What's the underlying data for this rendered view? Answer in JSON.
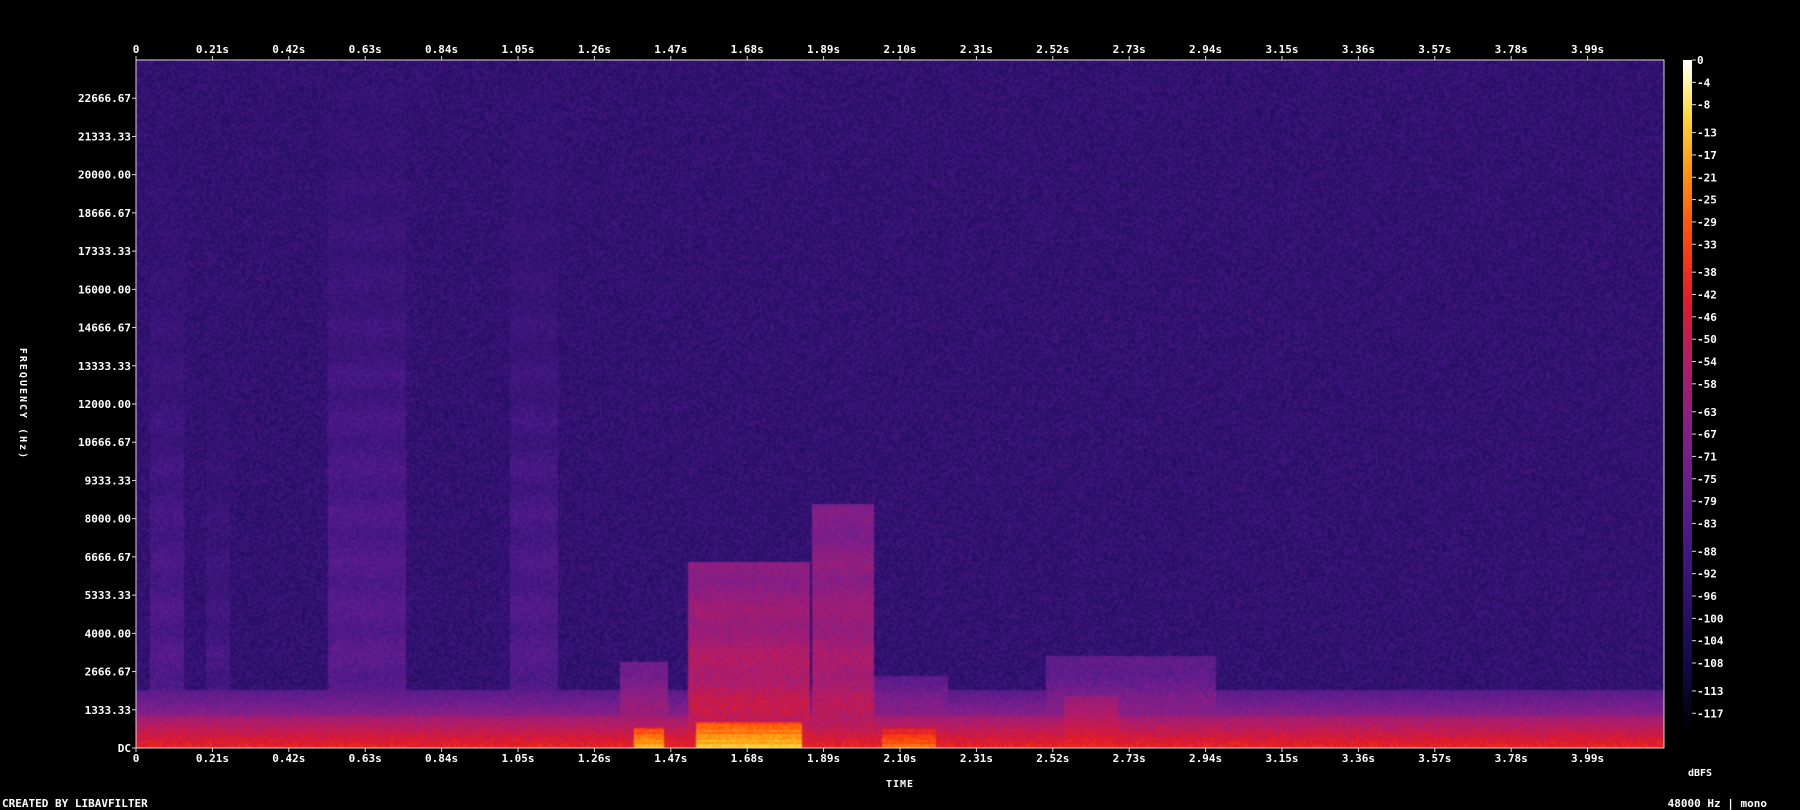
{
  "chart_data": {
    "type": "heatmap",
    "title": "",
    "xlabel": "TIME",
    "ylabel": "FREQUENCY (Hz)",
    "x_tick_labels": [
      "0",
      "0.21s",
      "0.42s",
      "0.63s",
      "0.84s",
      "1.05s",
      "1.26s",
      "1.47s",
      "1.68s",
      "1.89s",
      "2.10s",
      "2.31s",
      "2.52s",
      "2.73s",
      "2.94s",
      "3.15s",
      "3.36s",
      "3.57s",
      "3.78s",
      "3.99s"
    ],
    "x_ticks": [
      0,
      0.21,
      0.42,
      0.63,
      0.84,
      1.05,
      1.26,
      1.47,
      1.68,
      1.89,
      2.1,
      2.31,
      2.52,
      2.73,
      2.94,
      3.15,
      3.36,
      3.57,
      3.78,
      3.99
    ],
    "xlim": [
      0,
      4.2
    ],
    "y_tick_labels": [
      "DC",
      "1333.33",
      "2666.67",
      "4000.00",
      "5333.33",
      "6666.67",
      "8000.00",
      "9333.33",
      "10666.67",
      "12000.00",
      "13333.33",
      "14666.67",
      "16000.00",
      "17333.33",
      "18666.67",
      "20000.00",
      "21333.33",
      "22666.67"
    ],
    "y_ticks": [
      0,
      1333.33,
      2666.67,
      4000,
      5333.33,
      6666.67,
      8000,
      9333.33,
      10666.67,
      12000,
      13333.33,
      14666.67,
      16000,
      17333.33,
      18666.67,
      20000,
      21333.33,
      22666.67
    ],
    "ylim": [
      0,
      24000
    ],
    "colorbar": {
      "unit": "dBFS",
      "tick_labels": [
        "0",
        "-4",
        "-8",
        "-13",
        "-17",
        "-21",
        "-25",
        "-29",
        "-33",
        "-38",
        "-42",
        "-46",
        "-50",
        "-54",
        "-58",
        "-63",
        "-67",
        "-71",
        "-75",
        "-79",
        "-83",
        "-88",
        "-92",
        "-96",
        "-100",
        "-104",
        "-108",
        "-113",
        "-117"
      ],
      "range": [
        -120,
        0
      ],
      "colors": [
        "#000000",
        "#0b0a40",
        "#2a0f6a",
        "#4d1a8a",
        "#7a1f8c",
        "#b01c6a",
        "#e01a2a",
        "#ff4a0a",
        "#ff9a10",
        "#ffd93a",
        "#fff6b0",
        "#ffffff"
      ]
    },
    "background_level_dbfs": -95,
    "events": [
      {
        "t0": 0.04,
        "t1": 0.13,
        "fmax": 21000,
        "level": -82
      },
      {
        "t0": 0.19,
        "t1": 0.26,
        "fmax": 17000,
        "level": -86
      },
      {
        "t0": 0.53,
        "t1": 0.74,
        "fmax": 23000,
        "level": -80
      },
      {
        "t0": 1.03,
        "t1": 1.16,
        "fmax": 23000,
        "level": -82
      },
      {
        "t0": 1.33,
        "t1": 1.46,
        "fmax": 3000,
        "level": -55
      },
      {
        "t0": 1.52,
        "t1": 1.85,
        "fmax": 6500,
        "level": -48
      },
      {
        "t0": 1.86,
        "t1": 2.03,
        "fmax": 8500,
        "level": -52
      },
      {
        "t0": 2.03,
        "t1": 2.23,
        "fmax": 2500,
        "level": -60
      },
      {
        "t0": 2.5,
        "t1": 2.97,
        "fmax": 3200,
        "level": -62
      }
    ],
    "low_band_hot": [
      {
        "t0": 1.37,
        "t1": 1.45,
        "fmax": 700,
        "level": -18
      },
      {
        "t0": 1.54,
        "t1": 1.83,
        "fmax": 900,
        "level": -15
      },
      {
        "t0": 2.05,
        "t1": 2.2,
        "fmax": 700,
        "level": -28
      },
      {
        "t0": 2.55,
        "t1": 2.7,
        "fmax": 1800,
        "level": -45
      }
    ]
  },
  "footer": {
    "credit": "CREATED BY LIBAVFILTER",
    "info": "48000 Hz | mono"
  }
}
